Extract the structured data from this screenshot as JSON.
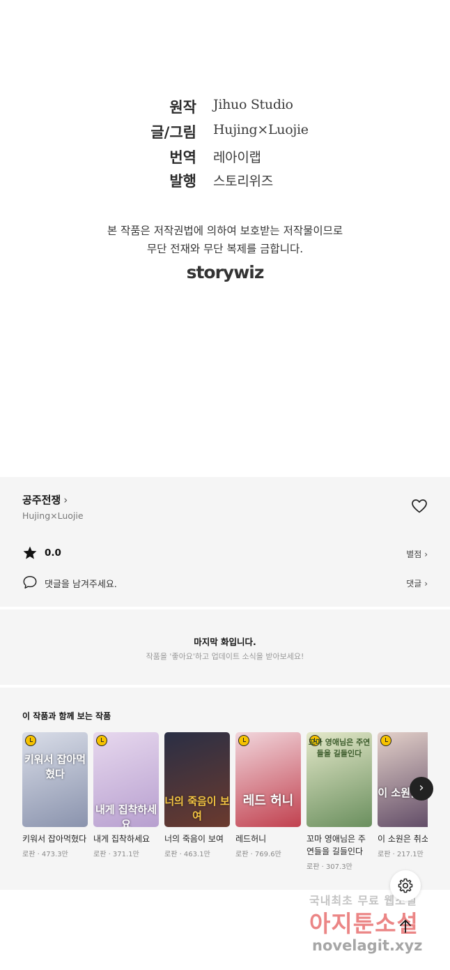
{
  "credits": {
    "rows": [
      {
        "role": "원작",
        "name": "Jihuo Studio"
      },
      {
        "role": "글/그림",
        "name": "Hujing×Luojie"
      },
      {
        "role": "번역",
        "name": "레아이랩"
      },
      {
        "role": "발행",
        "name": "스토리위즈"
      }
    ],
    "copyright_line1": "본 작품은 저작권법에 의하여 보호받는 저작물이므로",
    "copyright_line2": "무단 전재와 무단 복제를 금합니다.",
    "logo": "storywiz"
  },
  "work": {
    "title": "공주전쟁",
    "author": "Hujing×Luojie",
    "rating": "0.0",
    "rate_link": "별점",
    "comment_placeholder": "댓글을 남겨주세요.",
    "comment_link": "댓글"
  },
  "last_episode": {
    "title": "마지막 화입니다.",
    "subtitle": "작품을 '좋아요'하고 업데이트 소식을 받아보세요!"
  },
  "recommendations": {
    "heading": "이 작품과 함께 보는 작품",
    "items": [
      {
        "title": "키워서 잡아먹혔다",
        "meta": "로판 · 473.3만",
        "cover_text": "키워서 잡아먹혔다",
        "colors": [
          "#d9dde8",
          "#8a93ad"
        ]
      },
      {
        "title": "내게 집착하세요",
        "meta": "로판 · 371.1만",
        "cover_text": "내게 집착하세요",
        "colors": [
          "#e7d8ee",
          "#b79fcf"
        ]
      },
      {
        "title": "너의 죽음이 보여",
        "meta": "로판 · 463.1만",
        "cover_text": "너의 죽음이 보여",
        "colors": [
          "#2a2f45",
          "#6b3a2e"
        ]
      },
      {
        "title": "레드허니",
        "meta": "로판 · 769.6만",
        "cover_text": "레드 허니",
        "colors": [
          "#f1d6dc",
          "#c1414f"
        ]
      },
      {
        "title": "꼬마 영애님은 주연들을 길들인다",
        "meta": "로판 · 307.3만",
        "cover_text": "꼬마 영애님은 주연들을 길들인다",
        "colors": [
          "#e4e8c9",
          "#6a8f5e"
        ]
      },
      {
        "title": "이 소원은 취소",
        "meta": "로판 · 217.1만",
        "cover_text": "이 소원은 취소",
        "colors": [
          "#e3d0c9",
          "#5c4763"
        ]
      }
    ],
    "next_icon": "chevron-right-icon"
  },
  "watermark": {
    "line1": "국내최초 무료 웹소설",
    "line2": "아지툰소설",
    "line3": "novelagit.xyz"
  },
  "icons": {
    "heart": "heart-icon",
    "star": "star-icon",
    "comment": "speech-bubble-icon",
    "settings": "gear-icon",
    "scroll_top": "arrow-up-icon"
  }
}
